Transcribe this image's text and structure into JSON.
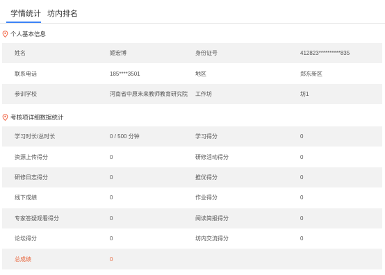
{
  "tabs": [
    {
      "label": "学情统计",
      "active": true
    },
    {
      "label": "坊内排名",
      "active": false
    }
  ],
  "sections": {
    "basic": "个人基本信息",
    "details": "考核项详细数据统计"
  },
  "colors": {
    "accent": "#3b82f6",
    "pin": "#f26d4f",
    "total_highlight": "#e8673e",
    "row_shade": "#f2f2f2"
  },
  "basic_info": [
    {
      "l1": "姓名",
      "v1": "姬宏博",
      "l2": "身份证号",
      "v2": "412823**********835"
    },
    {
      "l1": "联系电话",
      "v1": "185****3501",
      "l2": "地区",
      "v2": "郑东新区"
    },
    {
      "l1": "参训学校",
      "v1": "河南省中原未来教师教育研究院",
      "l2": "工作坊",
      "v2": "坊1"
    }
  ],
  "details": [
    {
      "l1": "学习时长/总时长",
      "v1": "0 / 500 分钟",
      "l2": "学习得分",
      "v2": "0"
    },
    {
      "l1": "资源上传得分",
      "v1": "0",
      "l2": "研修活动得分",
      "v2": "0"
    },
    {
      "l1": "研修日志得分",
      "v1": "0",
      "l2": "推优得分",
      "v2": "0"
    },
    {
      "l1": "线下成绩",
      "v1": "0",
      "l2": "作业得分",
      "v2": "0"
    },
    {
      "l1": "专家答疑观看得分",
      "v1": "0",
      "l2": "阅读简报得分",
      "v2": "0"
    },
    {
      "l1": "论坛得分",
      "v1": "0",
      "l2": "坊内交流得分",
      "v2": "0"
    },
    {
      "l1": "总成绩",
      "v1": "0",
      "l2": "",
      "v2": ""
    }
  ]
}
